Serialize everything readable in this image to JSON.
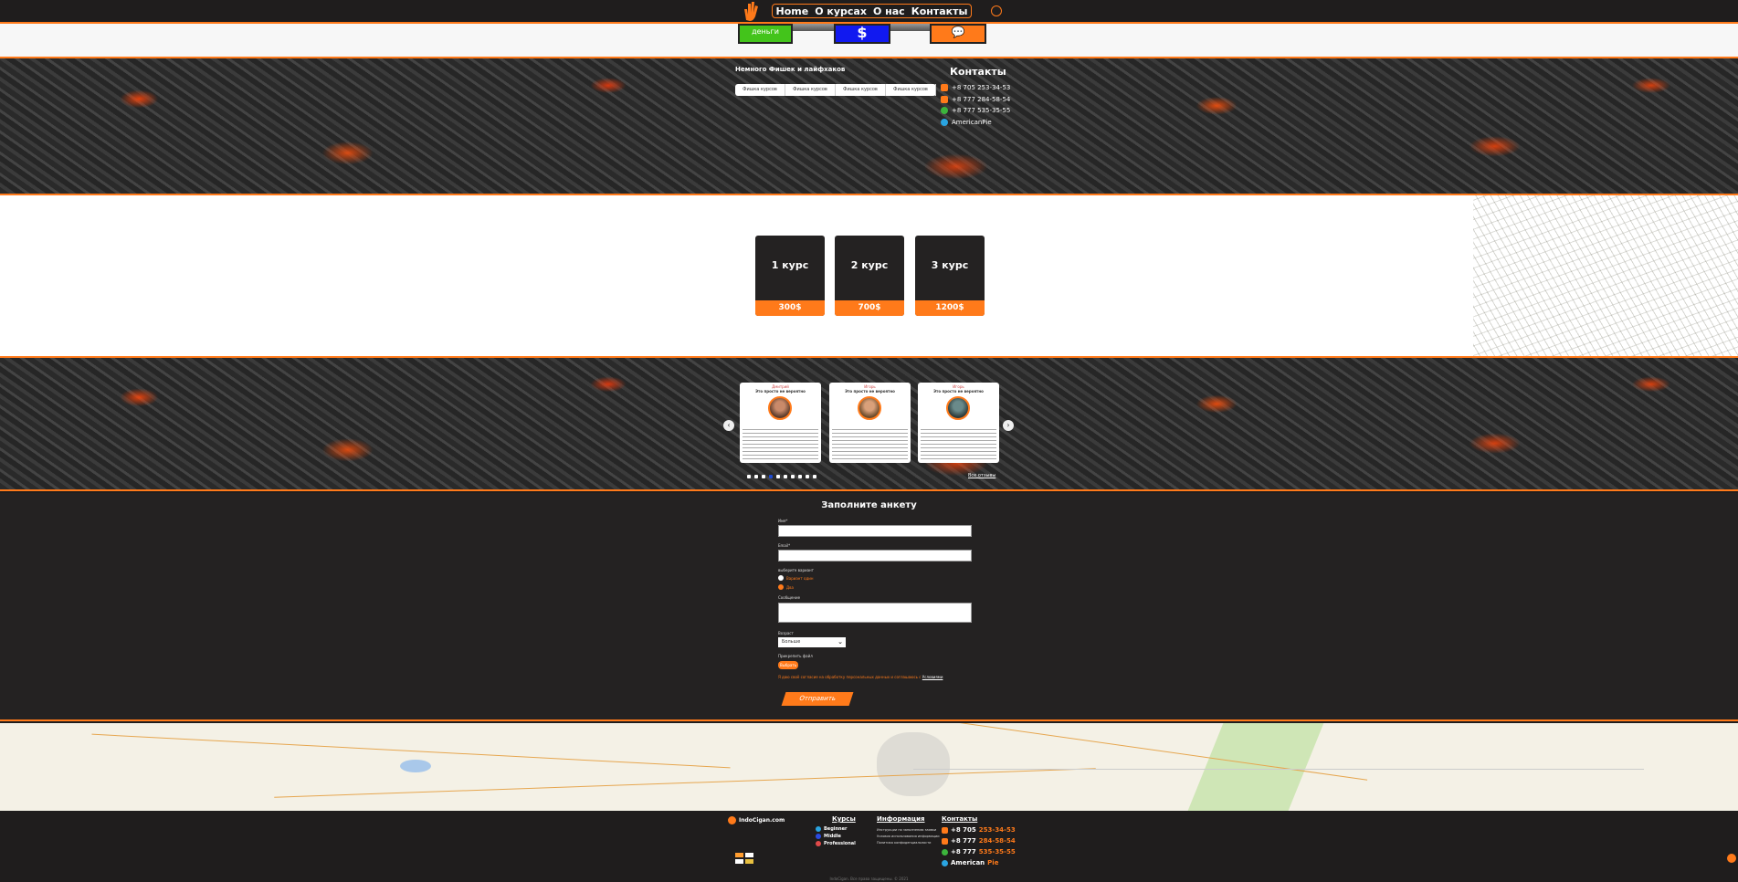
{
  "nav": {
    "items": [
      "Home",
      "О курсах",
      "О нас",
      "Контакты"
    ]
  },
  "top": {
    "green_label": "деньги",
    "blue_label": "$"
  },
  "about": {
    "title": "Немного Фишек и лайфхаков",
    "tabs": [
      "Фишка курсов",
      "Фишка курсов",
      "Фишка курсов",
      "Фишка курсов"
    ]
  },
  "contacts": {
    "title": "Контакты",
    "items": [
      {
        "text": "+8 705 253-34-53",
        "color": "#ff7a1a"
      },
      {
        "text": "+8 777 284-58-54",
        "color": "#ff7a1a"
      },
      {
        "text": "+8 777 535-35-55",
        "color": "#3cb43c"
      },
      {
        "text": "AmericanPie",
        "color": "#2aa4e0"
      }
    ]
  },
  "courses": [
    {
      "name": "1 курс",
      "price": "300$"
    },
    {
      "name": "2 курс",
      "price": "700$"
    },
    {
      "name": "3 курс",
      "price": "1200$"
    }
  ],
  "reviews": {
    "items": [
      {
        "name": "Дмитрий",
        "title": "Это просто не вероятно"
      },
      {
        "name": "Игорь",
        "title": "Это просто не вероятно"
      },
      {
        "name": "Игорь",
        "title": "Это просто не вероятно"
      }
    ],
    "prev": "‹",
    "next": "›",
    "all_label": "Все отзывы"
  },
  "form": {
    "title": "Заполните анкету",
    "name_label": "Имя*",
    "email_label": "Email*",
    "choice_label": "выберите вариант",
    "options": [
      "Вариант один",
      "Два"
    ],
    "message_label": "Сообщение",
    "select_label": "Возраст",
    "select_value": "Больше",
    "file_label": "Прикрепить файл",
    "file_button": "Выбрать",
    "agree_text": "Я даю своё согласие на обработку персональных данных и соглашаюсь с",
    "agree_link": "Условиями",
    "submit": "Отправить"
  },
  "footer": {
    "brand": "IndoCigan.com",
    "courses_title": "Курсы",
    "courses": [
      {
        "label": "Beginner",
        "color": "#e04a4a"
      },
      {
        "label": "Middle",
        "color": "#2aa4e0"
      },
      {
        "label": "Professional",
        "color": "#2a4ae0"
      }
    ],
    "info_title": "Информация",
    "info_items": [
      "Инструкции по заполнению заявки",
      "Условия использования информации",
      "Политика конфиденциальности"
    ],
    "contacts_title": "Контакты",
    "contacts": [
      {
        "prefix": "+8 705",
        "rest": "253-34-53",
        "color": "#ff7a1a"
      },
      {
        "prefix": "+8 777",
        "rest": "284-58-54",
        "color": "#ff7a1a"
      },
      {
        "prefix": "+8 777",
        "rest": "535-35-55",
        "color": "#3cb43c"
      },
      {
        "prefix": "American",
        "rest": "Pie",
        "color": "#2aa4e0"
      }
    ],
    "copyright": "IndoCigan. Все права защищены. © 2021"
  }
}
